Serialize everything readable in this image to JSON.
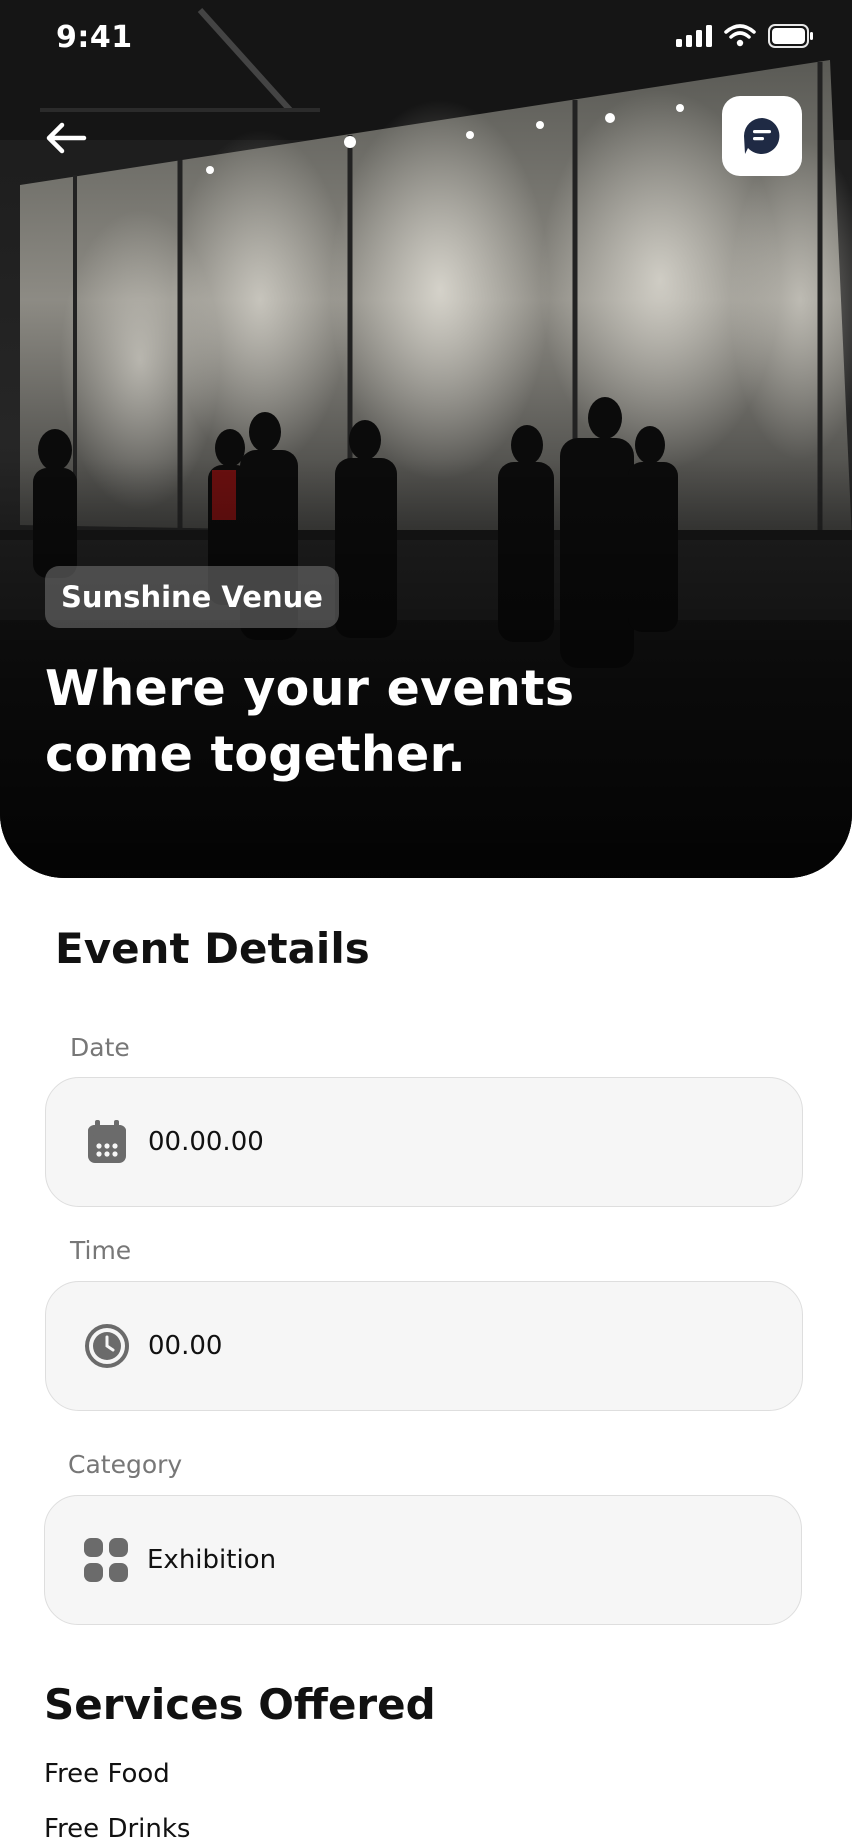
{
  "status_bar": {
    "time": "9:41"
  },
  "hero": {
    "venue_name": "Sunshine Venue",
    "headline_line1": "Where your events",
    "headline_line2": "come together."
  },
  "event_details": {
    "title": "Event Details",
    "date": {
      "label": "Date",
      "value": "00.00.00",
      "icon": "calendar-icon"
    },
    "time": {
      "label": "Time",
      "value": "00.00",
      "icon": "clock-icon"
    },
    "category": {
      "label": "Category",
      "value": "Exhibition",
      "icon": "grid-icon"
    }
  },
  "services": {
    "title": "Services Offered",
    "items": [
      "Free Food",
      "Free Drinks"
    ]
  },
  "colors": {
    "field_background": "#f6f6f6",
    "field_border": "#dedede",
    "chat_icon": "#1f2a44",
    "label_gray": "#777777"
  }
}
